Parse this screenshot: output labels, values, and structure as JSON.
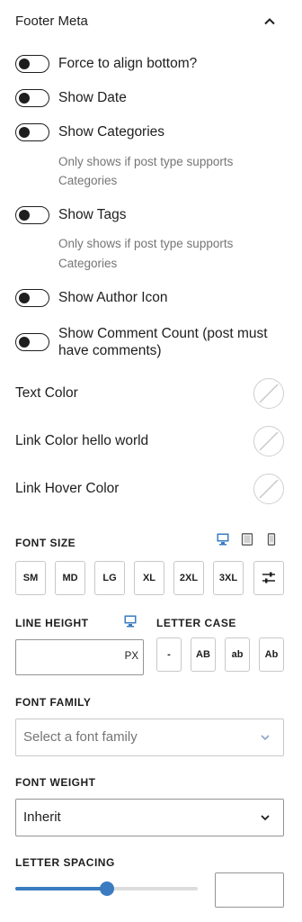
{
  "panel": {
    "title": "Footer Meta",
    "expanded": true
  },
  "toggles": [
    {
      "label": "Force to align bottom?",
      "on": false,
      "help": ""
    },
    {
      "label": "Show Date",
      "on": false,
      "help": ""
    },
    {
      "label": "Show Categories",
      "on": false,
      "help_line1": "Only shows if post type supports",
      "help_line2": "Categories"
    },
    {
      "label": "Show Tags",
      "on": false,
      "help_line1": "Only shows if post type supports",
      "help_line2": "Categories"
    },
    {
      "label": "Show Author Icon",
      "on": false,
      "help": ""
    },
    {
      "label_line1": "Show Comment Count (post must",
      "label_line2": "have comments)",
      "on": false
    }
  ],
  "colors": [
    {
      "label": "Text Color",
      "value": "none"
    },
    {
      "label": "Link Color hello world",
      "value": "none"
    },
    {
      "label": "Link Hover Color",
      "value": "none"
    }
  ],
  "font_size": {
    "label": "FONT SIZE",
    "devices": [
      "desktop-icon",
      "tablet-icon",
      "mobile-icon"
    ],
    "active_device": "desktop",
    "presets": [
      "SM",
      "MD",
      "LG",
      "XL",
      "2XL",
      "3XL"
    ],
    "custom_icon": "sliders-icon"
  },
  "line_height": {
    "label": "LINE HEIGHT",
    "value": "",
    "unit": "PX",
    "device_icon": "desktop-icon"
  },
  "letter_case": {
    "label": "LETTER CASE",
    "options": [
      "-",
      "AB",
      "ab",
      "Ab"
    ]
  },
  "font_family": {
    "label": "FONT FAMILY",
    "placeholder": "Select a font family"
  },
  "font_weight": {
    "label": "FONT WEIGHT",
    "value": "Inherit"
  },
  "letter_spacing": {
    "label": "LETTER SPACING",
    "slider_fraction": 0.5,
    "value": ""
  },
  "accent": "#3b7bbf"
}
